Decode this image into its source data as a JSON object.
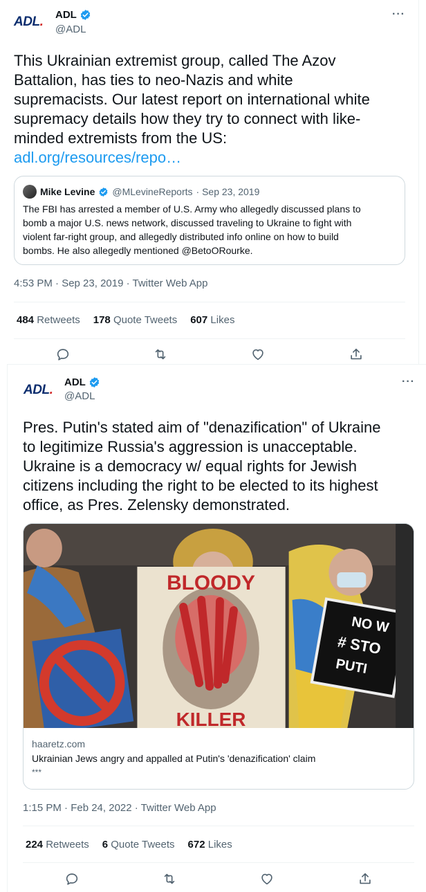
{
  "tweet1": {
    "logo": "ADL",
    "name": "ADL",
    "handle": "@ADL",
    "more": "···",
    "text_lines": [
      "This Ukrainian extremist group, called The Azov",
      "Battalion, has ties to neo-Nazis and white",
      "supremacists. Our latest report on international white",
      "supremacy details how they try to connect with like-",
      "minded extremists from the US:"
    ],
    "link": "adl.org/resources/repo…",
    "quote": {
      "name": "Mike Levine",
      "handle": "@MLevineReports",
      "date": "· Sep 23, 2019",
      "lines": [
        "The FBI has arrested a member of U.S. Army who allegedly discussed plans to",
        "bomb a major U.S. news network, discussed traveling to Ukraine to fight with",
        "violent far-right group, and allegedly distributed info online on how to build",
        "bombs. He also allegedly mentioned @BetoORourke."
      ]
    },
    "timestamp": "4:53 PM · Sep 23, 2019 · Twitter Web App",
    "stats": {
      "retweets": "484",
      "retweets_label": "Retweets",
      "quotes": "178",
      "quotes_label": "Quote Tweets",
      "likes": "607",
      "likes_label": "Likes"
    }
  },
  "tweet2": {
    "logo": "ADL",
    "name": "ADL",
    "handle": "@ADL",
    "more": "···",
    "text_lines": [
      "Pres. Putin's stated aim of \"denazification\" of Ukraine",
      "to legitimize Russia's aggression is unacceptable.",
      "Ukraine is a democracy w/ equal rights for Jewish",
      "citizens including the right to be elected to its highest",
      "office, as Pres. Zelensky demonstrated."
    ],
    "card": {
      "poster_top": "BLOODY",
      "poster_bottom": "KILLER",
      "sign_lines": [
        "NO W",
        "# STO",
        "PUTI"
      ],
      "domain": "haaretz.com",
      "title": "Ukrainian Jews angry and appalled at Putin's 'denazification' claim",
      "desc": "***"
    },
    "timestamp": "1:15 PM · Feb 24, 2022 · Twitter Web App",
    "stats": {
      "retweets": "224",
      "retweets_label": "Retweets",
      "quotes": "6",
      "quotes_label": "Quote Tweets",
      "likes": "672",
      "likes_label": "Likes"
    }
  },
  "colors": {
    "link": "#1d9bf0",
    "secondary": "#536471",
    "verified": "#1d9bf0",
    "logo_blue": "#0b2d6e",
    "logo_red": "#d12a2a"
  }
}
